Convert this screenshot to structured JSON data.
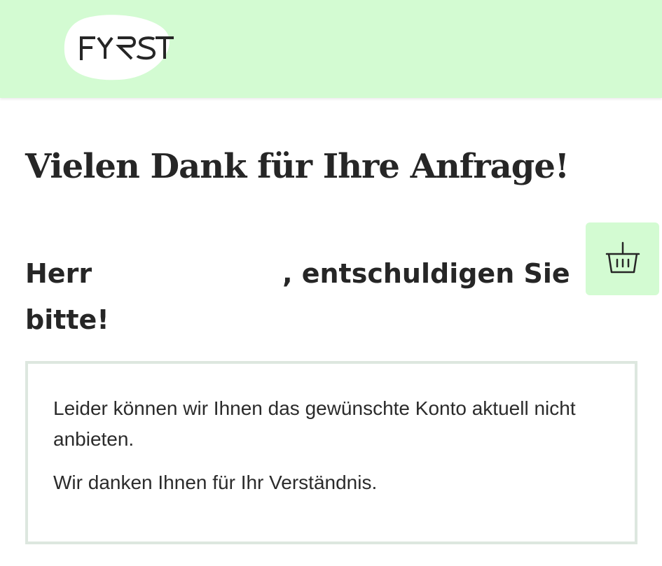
{
  "header": {
    "logo_text": "FYRST",
    "background_color": "#d3fbd2"
  },
  "headline": "Vielen Dank für Ihre Anfrage!",
  "greeting": {
    "salutation": "Herr",
    "suffix": ", entschuldigen Sie",
    "line2": "bitte!"
  },
  "basket_button": {
    "icon": "basket-icon"
  },
  "message": {
    "paragraph1": "Leider können wir Ihnen das gewünschte Konto aktuell nicht anbieten.",
    "paragraph2": "Wir danken Ihnen für Ihr Verständnis."
  },
  "colors": {
    "accent": "#d3fbd2",
    "border": "#dde7df",
    "text": "#2b2b2b"
  }
}
